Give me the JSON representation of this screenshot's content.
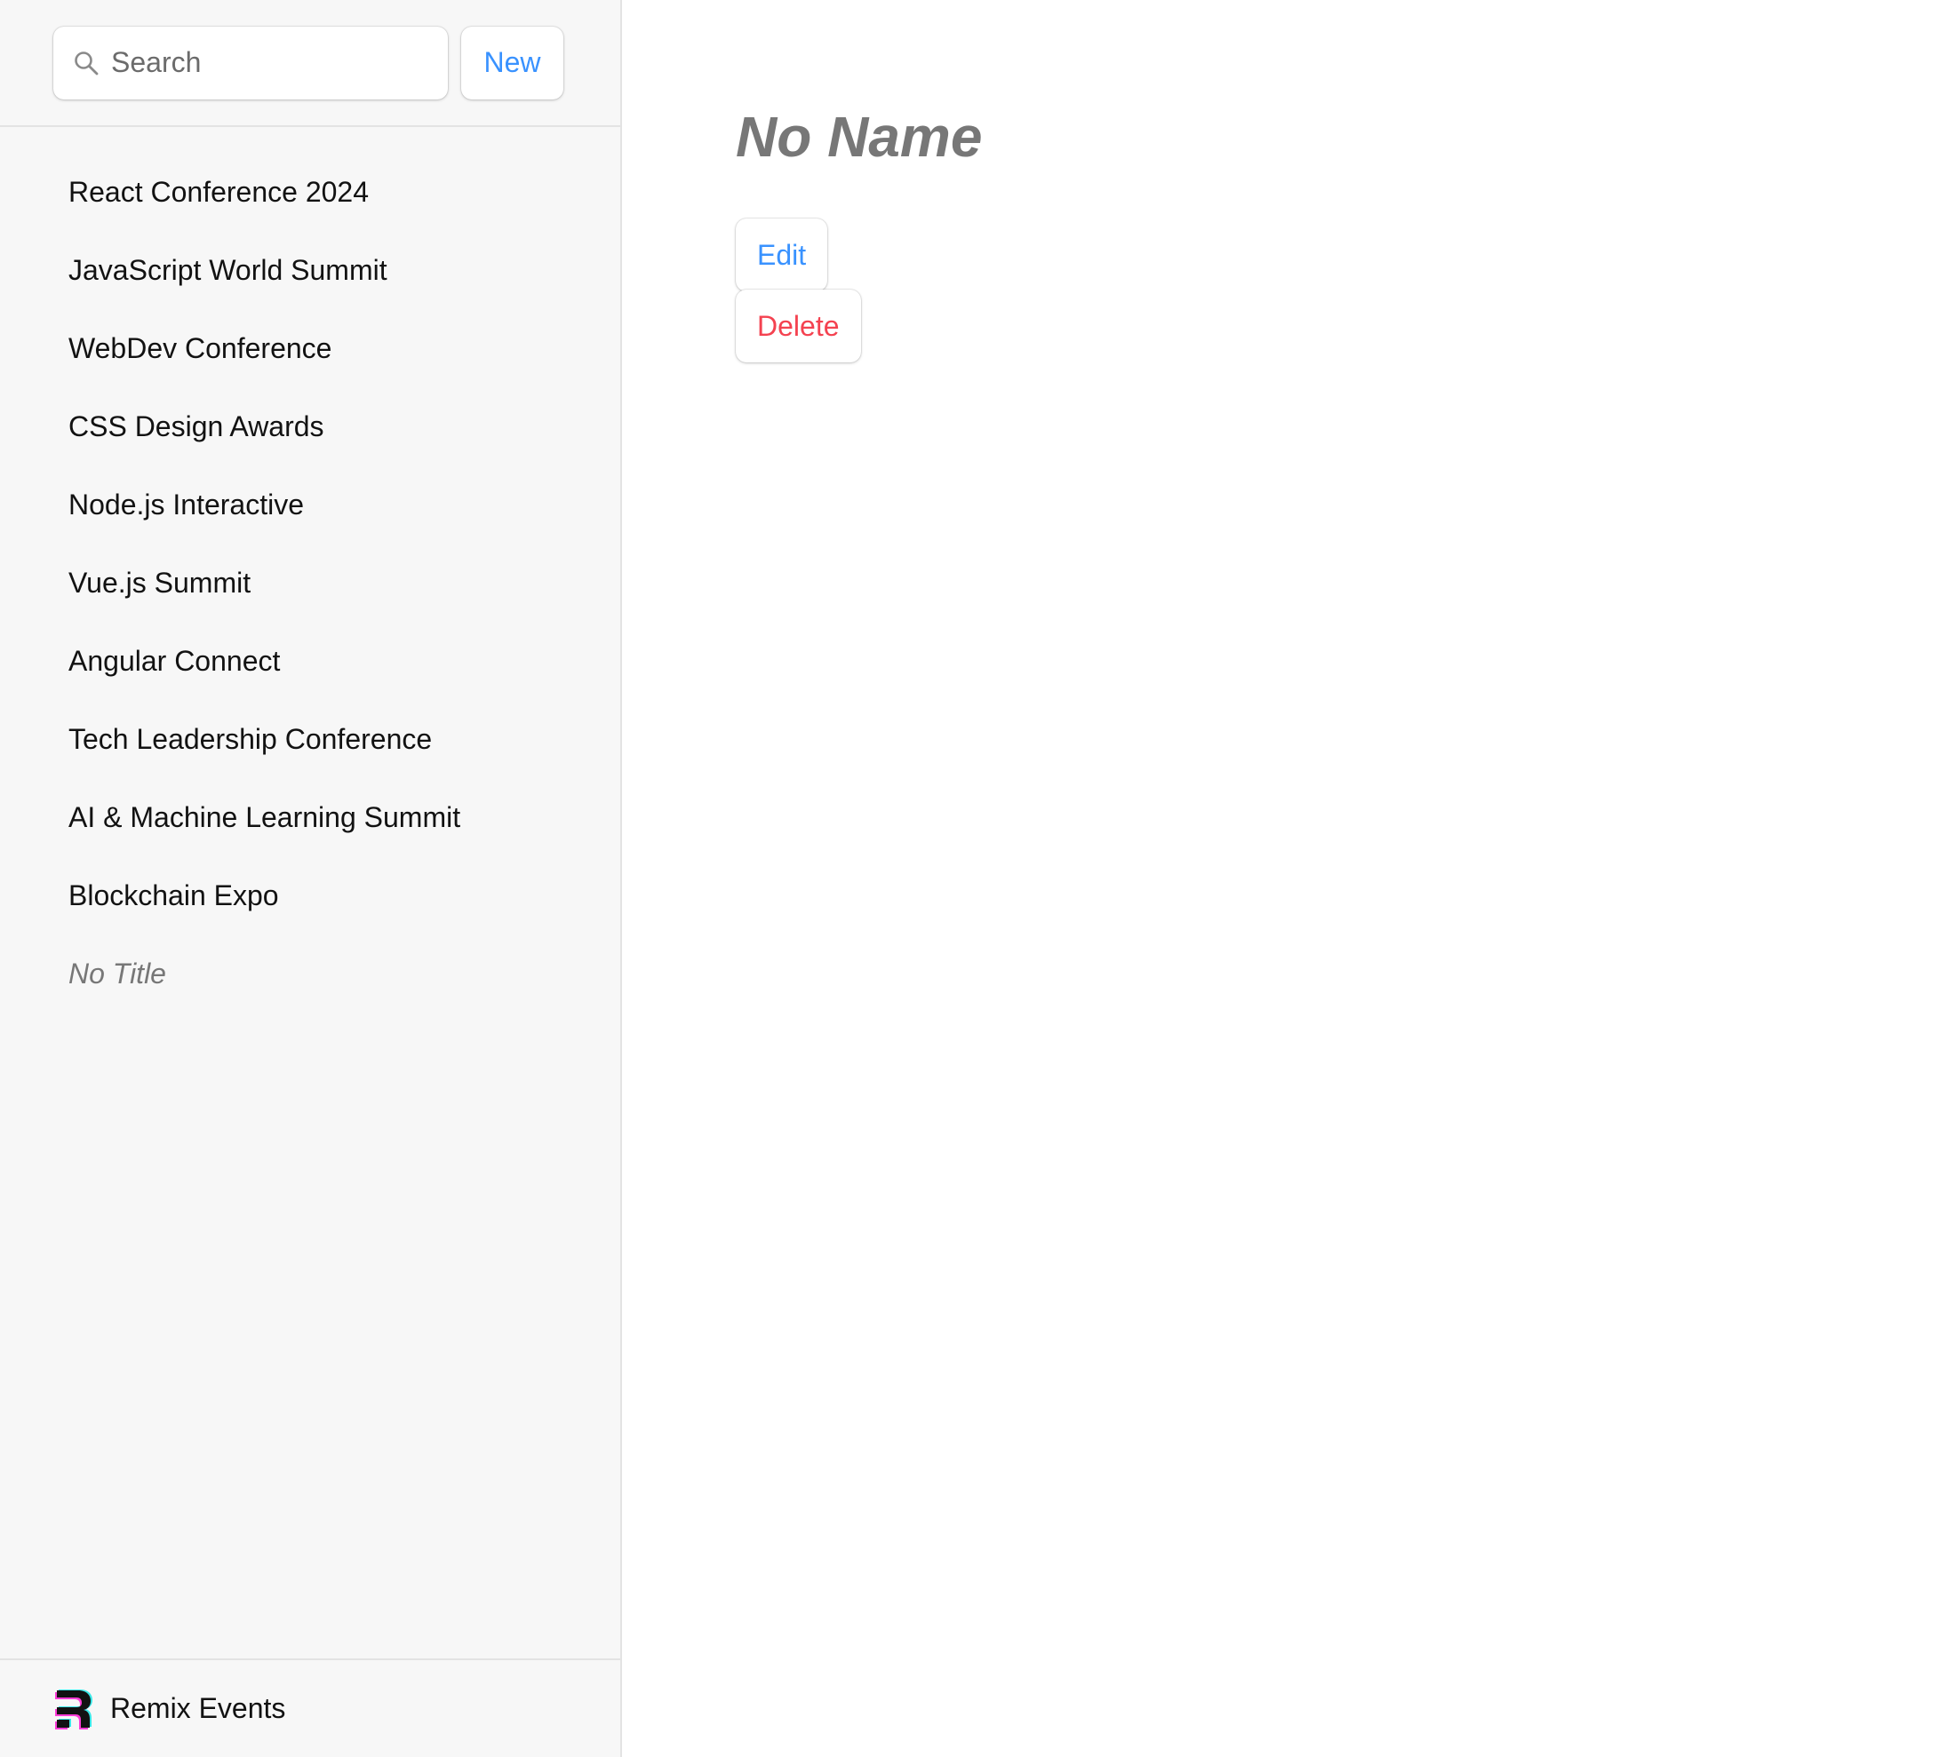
{
  "sidebar": {
    "search": {
      "placeholder": "Search",
      "value": "",
      "icon": "search-icon"
    },
    "new_label": "New",
    "events": [
      {
        "label": "React Conference 2024"
      },
      {
        "label": "JavaScript World Summit"
      },
      {
        "label": "WebDev Conference"
      },
      {
        "label": "CSS Design Awards"
      },
      {
        "label": "Node.js Interactive"
      },
      {
        "label": "Vue.js Summit"
      },
      {
        "label": "Angular Connect"
      },
      {
        "label": "Tech Leadership Conference"
      },
      {
        "label": "AI & Machine Learning Summit"
      },
      {
        "label": "Blockchain Expo"
      },
      {
        "label": "No Title"
      }
    ],
    "footer": {
      "logo_icon": "remix-logo-icon",
      "brand": "Remix Events"
    }
  },
  "detail": {
    "title": "No Name",
    "edit_label": "Edit",
    "delete_label": "Delete"
  },
  "colors": {
    "accent": "#3992ff",
    "danger": "#f44250",
    "sidebar_bg": "#f7f7f7",
    "muted": "#777777"
  }
}
